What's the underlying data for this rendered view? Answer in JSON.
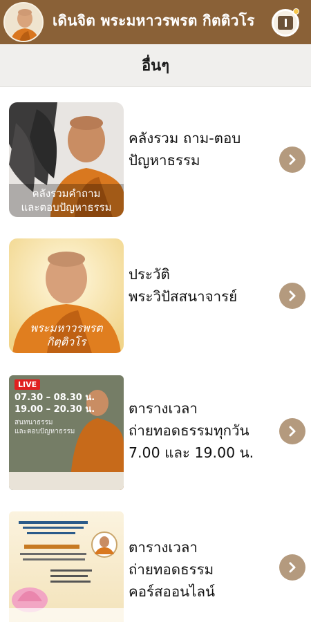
{
  "header": {
    "title": "เดินจิต พระมหาวรพรต กิตติวโร",
    "avatar_icon": "monk-avatar-icon",
    "menu_icon": "menu-icon",
    "color": "#8a6137"
  },
  "subheader": {
    "title": "อื่นๆ"
  },
  "items": [
    {
      "title": "คลังรวม ถาม-ตอบ\nปัญหาธรรม",
      "thumb_caption": "คลังรวมคำถาม\nและตอบปัญหาธรรม",
      "icon": "monk-leaf-thumbnail"
    },
    {
      "title": "ประวัติ\nพระวิปัสสนาจารย์",
      "thumb_caption": "พระมหาวรพรต\nกิตฺติวโร",
      "icon": "monk-portrait-thumbnail"
    },
    {
      "title": "ตารางเวลา\nถ่ายทอดธรรมทุกวัน\n7.00 และ 19.00 น.",
      "thumb_badge": "LIVE",
      "thumb_caption": "07.30 – 08.30 น.\n19.00 – 20.30 น.",
      "thumb_sub": "สนทนาธรรม\nและตอบปัญหาธรรม",
      "icon": "live-broadcast-thumbnail"
    },
    {
      "title": "ตารางเวลา\nถ่ายทอดธรรม\nคอร์สออนไลน์",
      "icon": "online-course-poster-thumbnail"
    }
  ]
}
